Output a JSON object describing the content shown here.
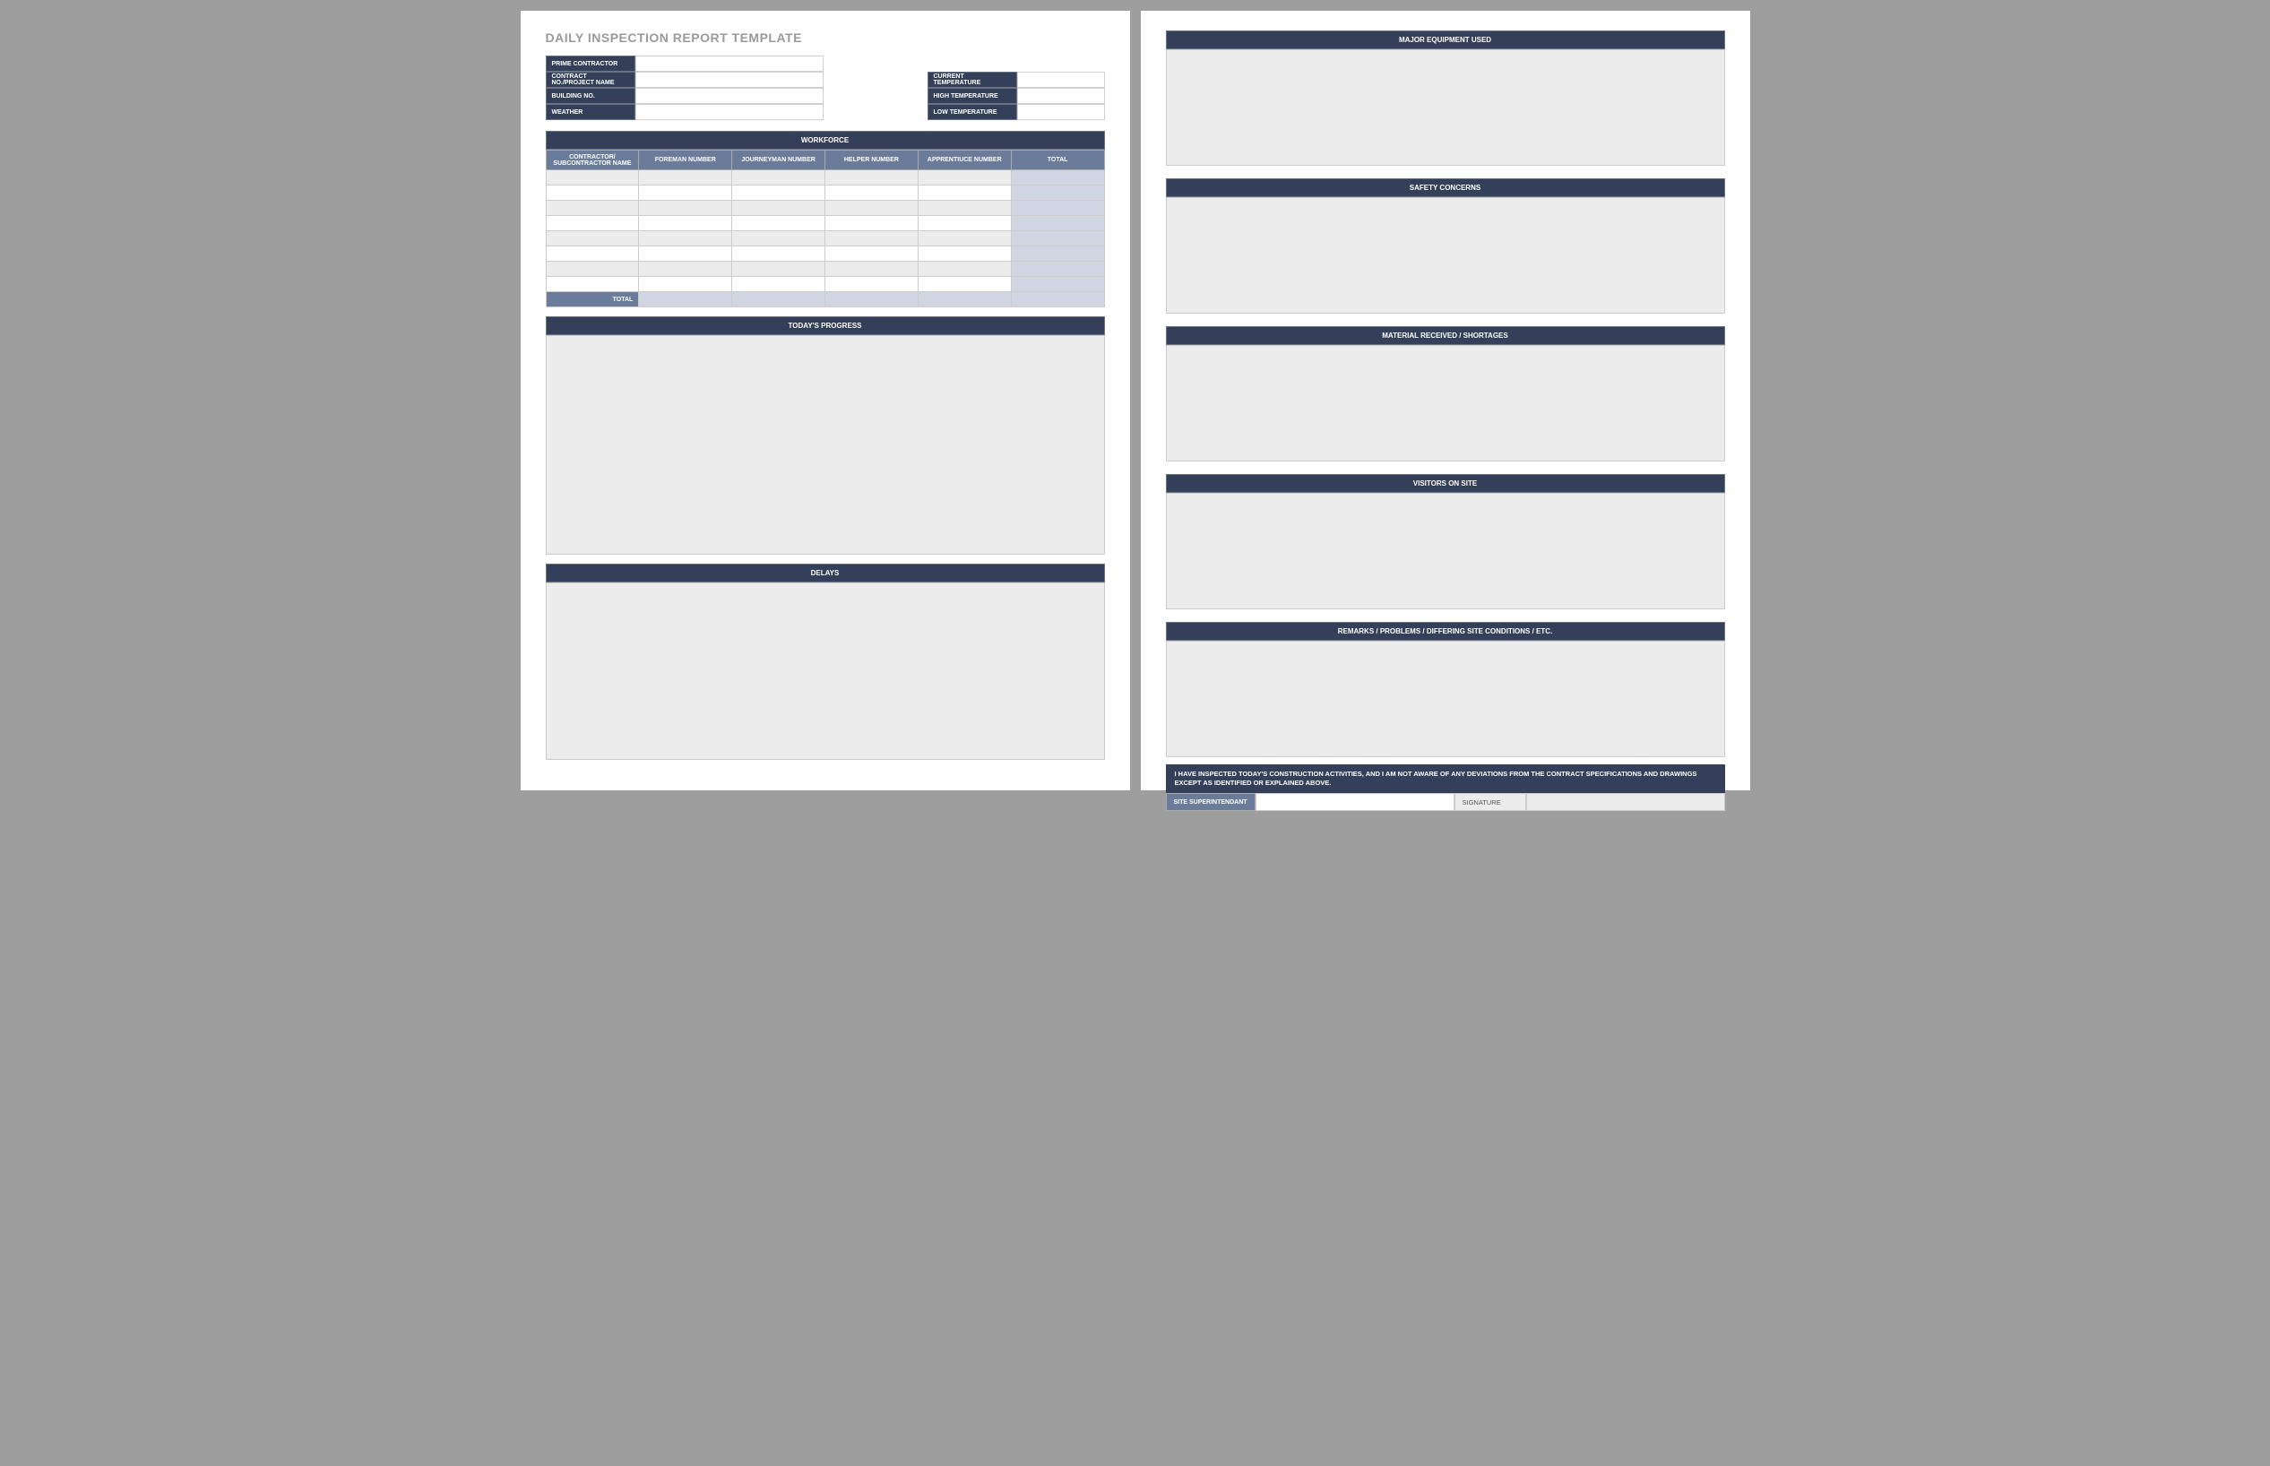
{
  "title": "DAILY INSPECTION REPORT TEMPLATE",
  "left_fields": {
    "prime_contractor": "PRIME CONTRACTOR",
    "contract_project": "CONTRACT NO./PROJECT NAME",
    "building_no": "BUILDING NO.",
    "weather": "WEATHER"
  },
  "right_fields": {
    "current_temp": "CURRENT TEMPERATURE",
    "high_temp": "HIGH TEMPERATURE",
    "low_temp": "LOW TEMPERATURE"
  },
  "workforce": {
    "header": "WORKFORCE",
    "columns": {
      "contractor": "CONTRACTOR/ SUBCONTRACTOR NAME",
      "foreman": "FOREMAN NUMBER",
      "journeyman": "JOURNEYMAN NUMBER",
      "helper": "HELPER NUMBER",
      "apprentice": "APPRENTIUCE NUMBER",
      "total": "TOTAL"
    },
    "total_label": "TOTAL"
  },
  "sections": {
    "progress": "TODAY'S PROGRESS",
    "delays": "DELAYS",
    "equipment": "MAJOR EQUIPMENT USED",
    "safety": "SAFETY CONCERNS",
    "material": "MATERIAL RECEIVED / SHORTAGES",
    "visitors": "VISITORS ON SITE",
    "remarks": "REMARKS / PROBLEMS / DIFFERING SITE CONDITIONS / ETC."
  },
  "certification": "I HAVE INSPECTED TODAY'S CONSTRUCTION ACTIVITIES, AND I AM NOT AWARE OF ANY DEVIATIONS FROM THE CONTRACT SPECIFICATIONS AND DRAWINGS EXCEPT AS IDENTIFIED OR EXPLAINED ABOVE.",
  "signature": {
    "superintendent": "SITE SUPERINTENDANT",
    "signature": "SIGNATURE"
  }
}
